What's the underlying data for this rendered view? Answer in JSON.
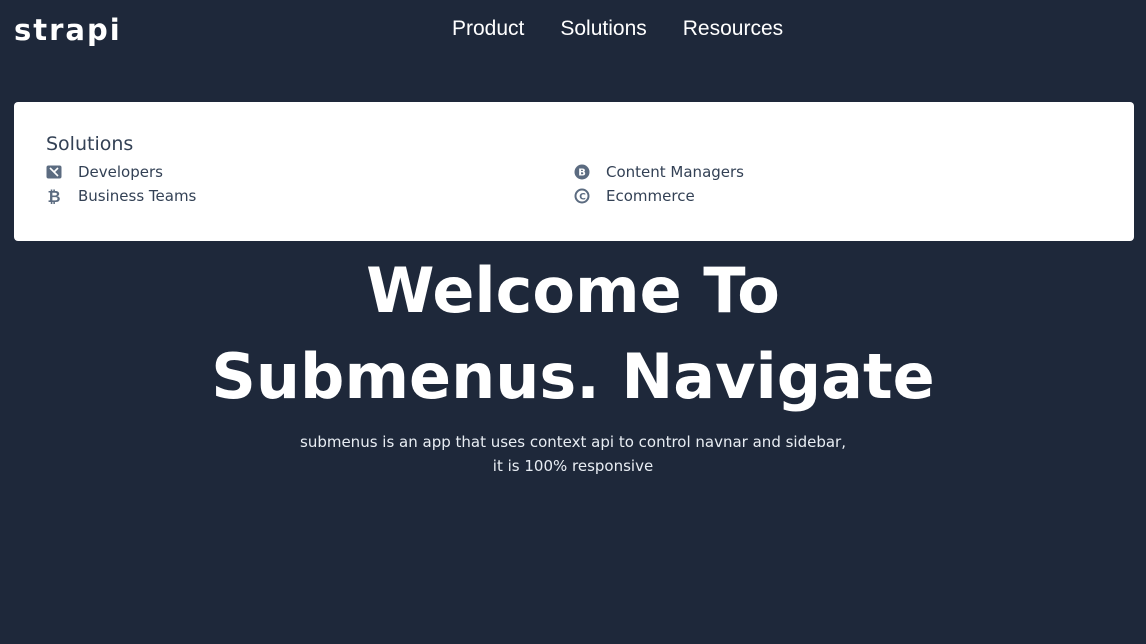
{
  "navbar": {
    "logo": "strapi",
    "links": [
      "Product",
      "Solutions",
      "Resources"
    ]
  },
  "submenu": {
    "title": "Solutions",
    "links": [
      {
        "label": "Developers",
        "icon": "developers-icon"
      },
      {
        "label": "Content Managers",
        "icon": "content-managers-icon"
      },
      {
        "label": "Business Teams",
        "icon": "bitcoin-icon"
      },
      {
        "label": "Ecommerce",
        "icon": "ecommerce-icon"
      }
    ]
  },
  "hero": {
    "title": "Welcome To Submenus. Navigate",
    "text": "submenus is an app that uses context api to control navnar and sidebar, it is 100% responsive"
  },
  "colors": {
    "background": "#1e283a",
    "submenu_bg": "#ffffff",
    "text_dark": "#334155"
  }
}
